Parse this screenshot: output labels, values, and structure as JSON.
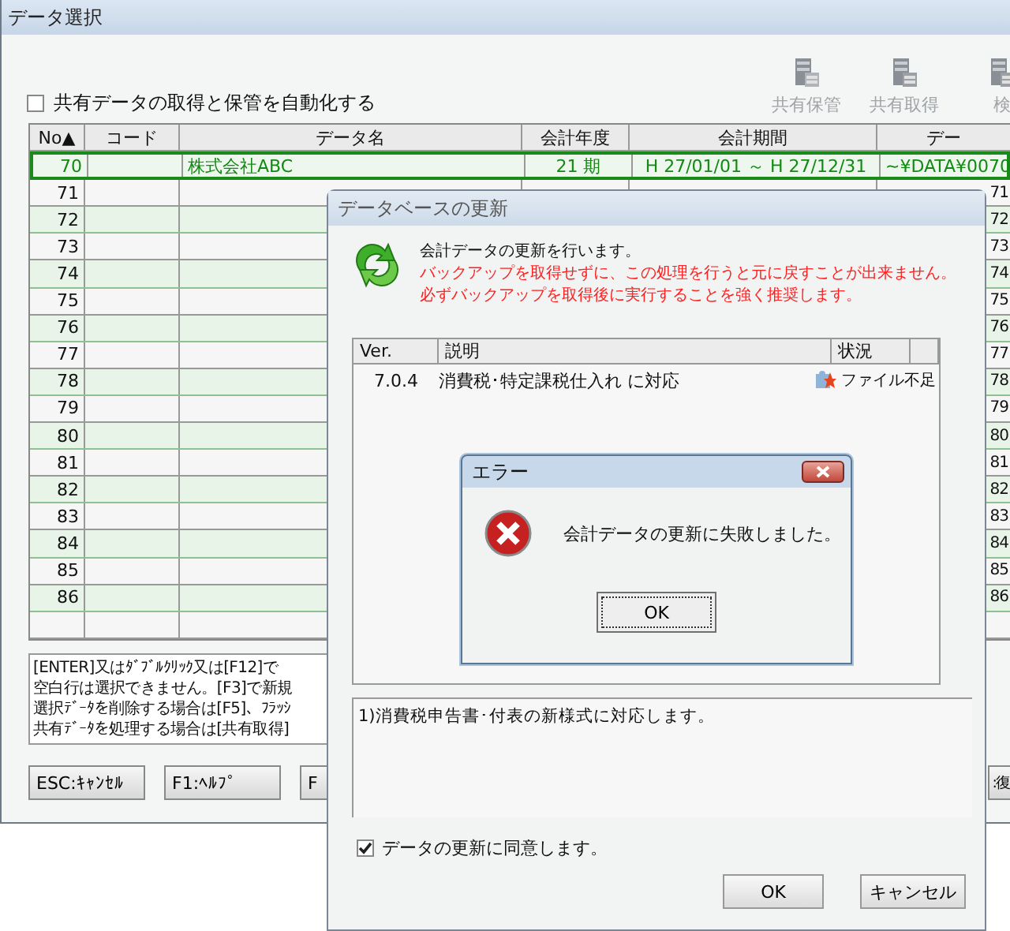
{
  "window": {
    "title": "データ選択"
  },
  "auto_share": {
    "label": "共有データの取得と保管を自動化する",
    "checked": false
  },
  "toolbar": [
    {
      "label": "共有保管"
    },
    {
      "label": "共有取得"
    },
    {
      "label": "検"
    }
  ],
  "table": {
    "columns": [
      "No▲",
      "コード",
      "データ名",
      "会計年度",
      "会計期間",
      "デー"
    ],
    "rows": [
      {
        "no": "70",
        "name": "株式会社ABC",
        "year": "21 期",
        "range": "H 27/01/01 ～ H 27/12/31",
        "path": "~¥DATA¥0070",
        "selected": true
      },
      {
        "no": "71",
        "path": "71",
        "selected": false
      },
      {
        "no": "72",
        "path": "72",
        "selected": false
      },
      {
        "no": "73",
        "path": "73",
        "selected": false
      },
      {
        "no": "74",
        "path": "74",
        "selected": false
      },
      {
        "no": "75",
        "path": "75",
        "selected": false
      },
      {
        "no": "76",
        "path": "76",
        "selected": false
      },
      {
        "no": "77",
        "path": "77",
        "selected": false
      },
      {
        "no": "78",
        "path": "78",
        "selected": false
      },
      {
        "no": "79",
        "path": "79",
        "selected": false
      },
      {
        "no": "80",
        "path": "80",
        "selected": false
      },
      {
        "no": "81",
        "path": "81",
        "selected": false
      },
      {
        "no": "82",
        "path": "82",
        "selected": false
      },
      {
        "no": "83",
        "path": "83",
        "selected": false
      },
      {
        "no": "84",
        "path": "84",
        "selected": false
      },
      {
        "no": "85",
        "path": "85",
        "selected": false
      },
      {
        "no": "86",
        "path": "86",
        "selected": false
      }
    ]
  },
  "help_lines": [
    "[ENTER]又はﾀﾞﾌﾞﾙｸﾘｯｸ又は[F12]で",
    "空白行は選択できません。[F3]で新規",
    "選択ﾃﾞｰﾀを削除する場合は[F5]、ﾌﾗｯｼ",
    "共有ﾃﾞｰﾀを処理する場合は[共有取得]"
  ],
  "buttons": [
    "ESC:ｷｬﾝｾﾙ",
    "F1:ﾍﾙﾌﾟ",
    "F"
  ],
  "side_button": ":復",
  "update_dialog": {
    "title": "データベースの更新",
    "intro": "会計データの更新を行います。",
    "warnings": [
      "バックアップを取得せずに、この処理を行うと元に戻すことが出来ません。",
      "必ずバックアップを取得後に実行することを強く推奨します。"
    ],
    "columns": [
      "Ver.",
      "説明",
      "状況"
    ],
    "items": [
      {
        "ver": "7.0.4",
        "desc": "消費税･特定課税仕入れ に対応",
        "status": "ファイル不足"
      }
    ],
    "note": "1)消費税申告書･付表の新様式に対応します。",
    "agree": {
      "label": "データの更新に同意します。",
      "checked": true
    },
    "buttons": [
      "OK",
      "キャンセル"
    ]
  },
  "error_dialog": {
    "title": "エラー",
    "message": "会計データの更新に失敗しました。",
    "button": "OK"
  }
}
